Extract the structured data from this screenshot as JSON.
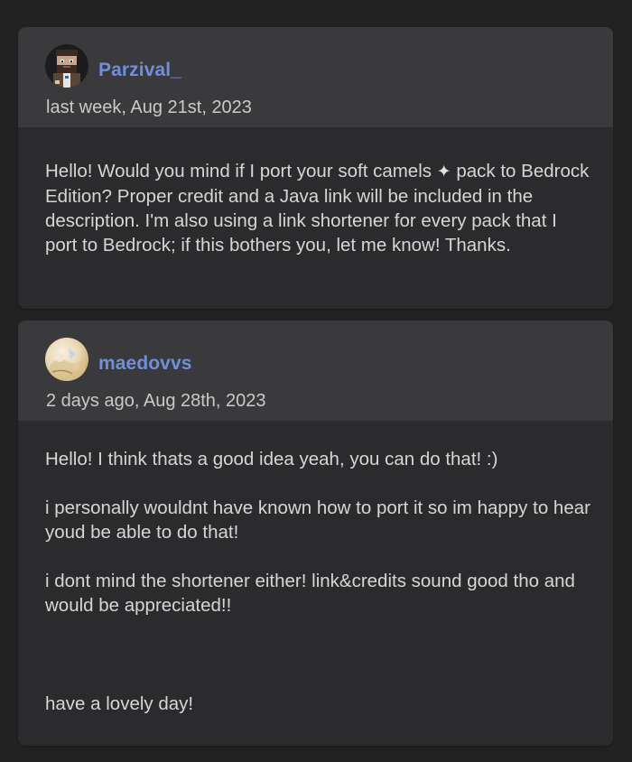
{
  "comments": [
    {
      "author": "Parzival_",
      "avatar_icon": "pixel-character-avatar-icon",
      "timestamp": "last week, Aug 21st, 2023",
      "body_before_sparkle": "Hello! Would you mind if I port your soft camels",
      "sparkle_glyph": "✦",
      "body_after_sparkle": "pack to Bedrock Edition? Proper credit and a Java link will be included in the description. I'm also using a link shortener for every pack that I port to Bedrock; if this bothers you, let me know! Thanks."
    },
    {
      "author": "maedovvs",
      "avatar_icon": "pastel-photo-avatar-icon",
      "timestamp": "2 days ago, Aug 28th, 2023",
      "paragraphs": [
        "Hello! I think thats a good idea yeah, you can do that! :)",
        "i personally wouldnt have known how to port it so im happy to hear youd be able to do that!",
        "i dont mind the shortener either! link&credits sound good tho and would be appreciated!!",
        "have a lovely day!"
      ]
    }
  ],
  "colors": {
    "background": "#222223",
    "card": "#2b2b2d",
    "card_header": "#3a3a3c",
    "username": "#6f8fd8",
    "text": "#d6d6d6"
  }
}
